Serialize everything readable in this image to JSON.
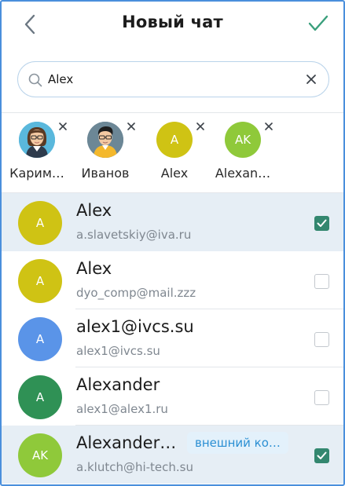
{
  "header": {
    "title": "Новый чат",
    "back_icon": "chevron-left-icon",
    "confirm_icon": "check-icon",
    "accent_color": "#3a9f7c"
  },
  "search": {
    "value": "Alex",
    "icon": "search-icon",
    "clear_icon": "close-icon"
  },
  "selected": [
    {
      "name": "Карим…",
      "avatar_type": "photo-woman",
      "initials": ""
    },
    {
      "name": "Иванов",
      "avatar_type": "photo-man",
      "initials": ""
    },
    {
      "name": "Alex",
      "avatar_type": "initials",
      "initials": "A",
      "color": "#cfc314"
    },
    {
      "name": "Alexan…",
      "avatar_type": "initials",
      "initials": "AK",
      "color": "#8fc93a"
    }
  ],
  "contacts": [
    {
      "initials": "A",
      "color": "#cfc314",
      "name": "Alex",
      "email": "a.slavetskiy@iva.ru",
      "checked": true,
      "badge": ""
    },
    {
      "initials": "A",
      "color": "#cfc314",
      "name": "Alex",
      "email": "dyo_comp@mail.zzz",
      "checked": false,
      "badge": ""
    },
    {
      "initials": "A",
      "color": "#5a94e8",
      "name": "alex1@ivcs.su",
      "email": "alex1@ivcs.su",
      "checked": false,
      "badge": ""
    },
    {
      "initials": "A",
      "color": "#2f9155",
      "name": "Alexander",
      "email": "alex1@alex1.ru",
      "checked": false,
      "badge": ""
    },
    {
      "initials": "AK",
      "color": "#8fc93a",
      "name": "Alexander…",
      "email": "a.klutch@hi-tech.su",
      "checked": true,
      "badge": "внешний ко…"
    }
  ],
  "colors": {
    "selected_row_bg": "#e6eef5",
    "checkbox_checked": "#33876f",
    "badge_text": "#2b8fd3",
    "badge_bg": "#e3f1fb",
    "search_border": "#b9d3ea"
  }
}
